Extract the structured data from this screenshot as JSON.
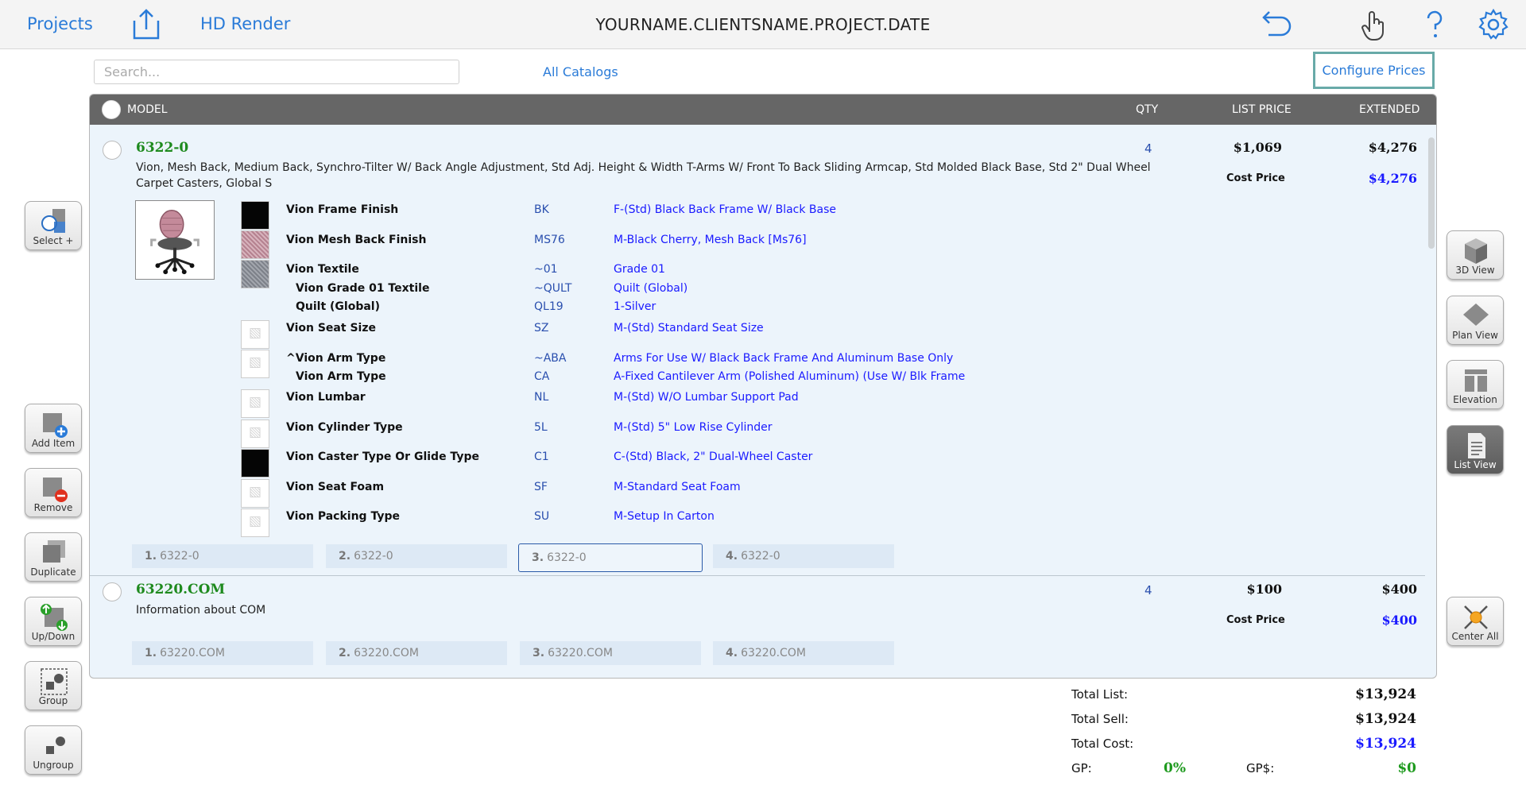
{
  "topbar": {
    "projects_label": "Projects",
    "hd_render_label": "HD Render",
    "title": "YOURNAME.CLIENTSNAME.PROJECT.DATE"
  },
  "search": {
    "placeholder": "Search...",
    "value": ""
  },
  "all_catalogs_label": "All Catalogs",
  "configure_prices_label": "Configure Prices",
  "table_header": {
    "model": "MODEL",
    "qty": "QTY",
    "list_price": "LIST PRICE",
    "extended": "EXTENDED"
  },
  "items": [
    {
      "code": "6322-0",
      "description_line1": "Vion, Mesh Back, Medium Back, Synchro-Tilter W/ Back Angle Adjustment, Std Adj. Height & Width T-Arms W/ Front To Back Sliding Armcap, Std Molded Black Base, Std 2\" Dual Wheel",
      "description_line2": "Carpet Casters, Global S",
      "qty": "4",
      "list_price": "$1,069",
      "extended": "$4,276",
      "cost_label": "Cost Price",
      "cost_value": "$4,276",
      "options": [
        {
          "name": "Vion Frame Finish",
          "code": "BK",
          "value": "F-(Std) Black Back Frame W/ Black Base"
        },
        {
          "name": "Vion Mesh Back Finish",
          "code": "MS76",
          "value": "M-Black Cherry, Mesh Back [Ms76]"
        },
        {
          "name": "Vion Textile",
          "code": "~01",
          "value": "Grade 01"
        },
        {
          "name": "Vion Grade 01 Textile",
          "code": "~QULT",
          "value": "Quilt (Global)"
        },
        {
          "name": "Quilt (Global)",
          "code": "QL19",
          "value": "1-Silver"
        },
        {
          "name": "Vion Seat Size",
          "code": "SZ",
          "value": "M-(Std) Standard Seat Size"
        },
        {
          "name": "^Vion Arm Type",
          "code": "~ABA",
          "value": "Arms For Use W/ Black Back Frame And Aluminum Base Only"
        },
        {
          "name": "Vion Arm Type",
          "code": "CA",
          "value": "A-Fixed Cantilever Arm (Polished Aluminum) (Use W/ Blk Frame"
        },
        {
          "name": "Vion Lumbar",
          "code": "NL",
          "value": "M-(Std) W/O Lumbar Support Pad"
        },
        {
          "name": "Vion Cylinder Type",
          "code": "5L",
          "value": "M-(Std) 5\" Low Rise Cylinder"
        },
        {
          "name": "Vion Caster Type Or Glide Type",
          "code": "C1",
          "value": "C-(Std) Black, 2\" Dual-Wheel Caster"
        },
        {
          "name": "Vion Seat Foam",
          "code": "SF",
          "value": "M-Standard Seat Foam"
        },
        {
          "name": "Vion Packing Type",
          "code": "SU",
          "value": "M-Setup In Carton"
        }
      ],
      "tags": [
        {
          "num": "1.",
          "label": "6322-0"
        },
        {
          "num": "2.",
          "label": "6322-0"
        },
        {
          "num": "3.",
          "label": "6322-0"
        },
        {
          "num": "4.",
          "label": "6322-0"
        }
      ]
    },
    {
      "code": "63220.COM",
      "description_line1": "Information about COM",
      "qty": "4",
      "list_price": "$100",
      "extended": "$400",
      "cost_label": "Cost Price",
      "cost_value": "$400",
      "tags": [
        {
          "num": "1.",
          "label": "63220.COM"
        },
        {
          "num": "2.",
          "label": "63220.COM"
        },
        {
          "num": "3.",
          "label": "63220.COM"
        },
        {
          "num": "4.",
          "label": "63220.COM"
        }
      ]
    }
  ],
  "left_tools": {
    "select": "Select +",
    "add_item": "Add Item",
    "remove": "Remove",
    "duplicate": "Duplicate",
    "up_down": "Up/Down",
    "group": "Group",
    "ungroup": "Ungroup"
  },
  "right_tools": {
    "view_3d": "3D View",
    "plan_view": "Plan View",
    "elevation": "Elevation",
    "list_view": "List View",
    "center_all": "Center All"
  },
  "totals": {
    "total_list_label": "Total List:",
    "total_list": "$13,924",
    "total_sell_label": "Total Sell:",
    "total_sell": "$13,924",
    "total_cost_label": "Total Cost:",
    "total_cost": "$13,924",
    "gp_label": "GP:",
    "gp": "0%",
    "gp_dollar_label": "GP$:",
    "gp_dollar": "$0"
  },
  "colors": {
    "accent_blue": "#2a7bd8",
    "code_green": "#1e8a1e",
    "cost_blue": "#1a1aff",
    "header_gray": "#666666"
  }
}
